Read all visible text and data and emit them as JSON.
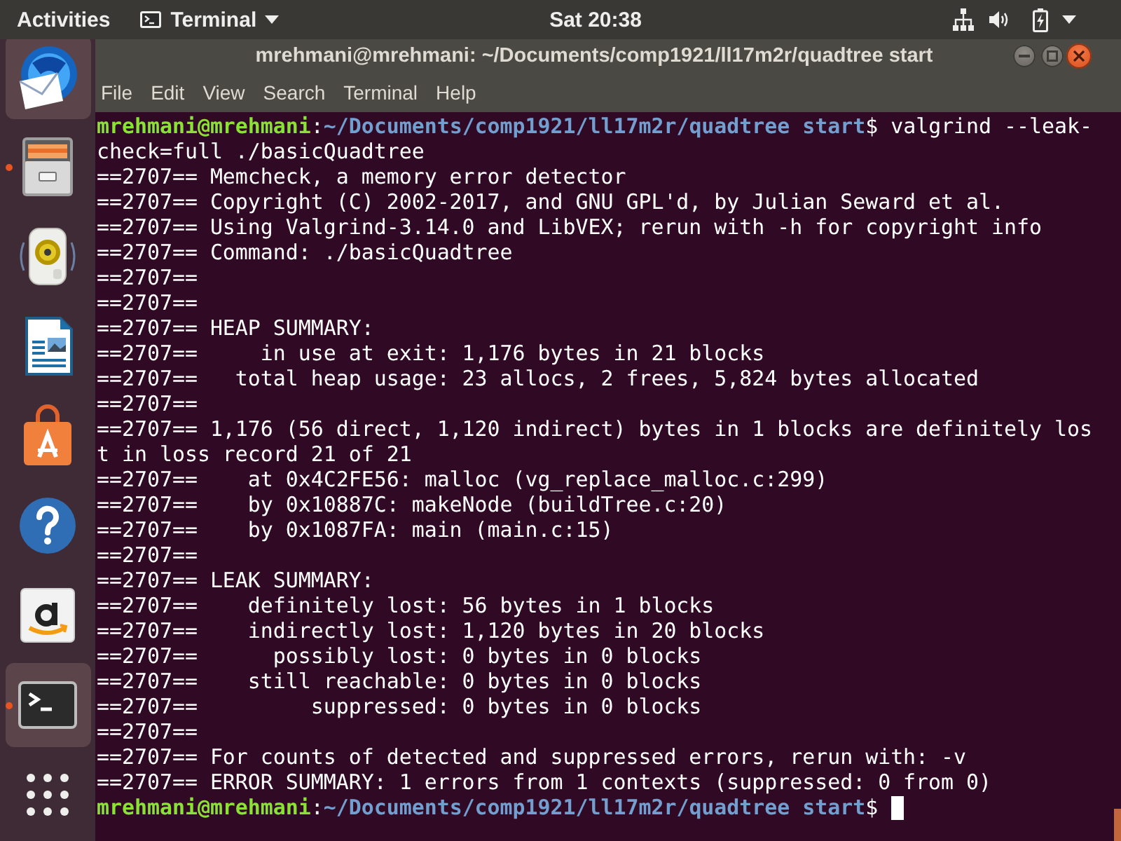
{
  "top_bar": {
    "activities": "Activities",
    "app_menu": "Terminal",
    "clock": "Sat 20:38"
  },
  "dock": {
    "items": [
      {
        "kind": "mail",
        "running": false,
        "highlighted": true
      },
      {
        "kind": "files",
        "running": true,
        "highlighted": false
      },
      {
        "kind": "music",
        "running": false,
        "highlighted": false
      },
      {
        "kind": "writer",
        "running": false,
        "highlighted": false
      },
      {
        "kind": "software",
        "running": false,
        "highlighted": false
      },
      {
        "kind": "help",
        "running": false,
        "highlighted": false
      },
      {
        "kind": "shop",
        "running": false,
        "highlighted": false
      },
      {
        "kind": "terminal",
        "running": true,
        "highlighted": true
      },
      {
        "kind": "apps",
        "running": false,
        "highlighted": false
      }
    ]
  },
  "window": {
    "title": "mrehmani@mrehmani: ~/Documents/comp1921/ll17m2r/quadtree start",
    "menu": [
      "File",
      "Edit",
      "View",
      "Search",
      "Terminal",
      "Help"
    ]
  },
  "terminal": {
    "cursor": true,
    "lines": [
      {
        "kind": "prompt",
        "user_host": "mrehmani@mrehmani",
        "separator": ":",
        "path": "~/Documents/comp1921/ll17m2r/quadtree start",
        "command": "$ valgrind --leak-"
      },
      {
        "kind": "output",
        "text": "check=full ./basicQuadtree"
      },
      {
        "kind": "output",
        "text": "==2707== Memcheck, a memory error detector"
      },
      {
        "kind": "output",
        "text": "==2707== Copyright (C) 2002-2017, and GNU GPL'd, by Julian Seward et al."
      },
      {
        "kind": "output",
        "text": "==2707== Using Valgrind-3.14.0 and LibVEX; rerun with -h for copyright info"
      },
      {
        "kind": "output",
        "text": "==2707== Command: ./basicQuadtree"
      },
      {
        "kind": "output",
        "text": "==2707=="
      },
      {
        "kind": "output",
        "text": "==2707=="
      },
      {
        "kind": "output",
        "text": "==2707== HEAP SUMMARY:"
      },
      {
        "kind": "output",
        "text": "==2707==     in use at exit: 1,176 bytes in 21 blocks"
      },
      {
        "kind": "output",
        "text": "==2707==   total heap usage: 23 allocs, 2 frees, 5,824 bytes allocated"
      },
      {
        "kind": "output",
        "text": "==2707=="
      },
      {
        "kind": "output",
        "text": "==2707== 1,176 (56 direct, 1,120 indirect) bytes in 1 blocks are definitely los"
      },
      {
        "kind": "output",
        "text": "t in loss record 21 of 21"
      },
      {
        "kind": "output",
        "text": "==2707==    at 0x4C2FE56: malloc (vg_replace_malloc.c:299)"
      },
      {
        "kind": "output",
        "text": "==2707==    by 0x10887C: makeNode (buildTree.c:20)"
      },
      {
        "kind": "output",
        "text": "==2707==    by 0x1087FA: main (main.c:15)"
      },
      {
        "kind": "output",
        "text": "==2707=="
      },
      {
        "kind": "output",
        "text": "==2707== LEAK SUMMARY:"
      },
      {
        "kind": "output",
        "text": "==2707==    definitely lost: 56 bytes in 1 blocks"
      },
      {
        "kind": "output",
        "text": "==2707==    indirectly lost: 1,120 bytes in 20 blocks"
      },
      {
        "kind": "output",
        "text": "==2707==      possibly lost: 0 bytes in 0 blocks"
      },
      {
        "kind": "output",
        "text": "==2707==    still reachable: 0 bytes in 0 blocks"
      },
      {
        "kind": "output",
        "text": "==2707==         suppressed: 0 bytes in 0 blocks"
      },
      {
        "kind": "output",
        "text": "==2707=="
      },
      {
        "kind": "output",
        "text": "==2707== For counts of detected and suppressed errors, rerun with: -v"
      },
      {
        "kind": "output",
        "text": "==2707== ERROR SUMMARY: 1 errors from 1 contexts (suppressed: 0 from 0)"
      },
      {
        "kind": "prompt",
        "user_host": "mrehmani@mrehmani",
        "separator": ":",
        "path": "~/Documents/comp1921/ll17m2r/quadtree start",
        "command": "$"
      }
    ]
  }
}
